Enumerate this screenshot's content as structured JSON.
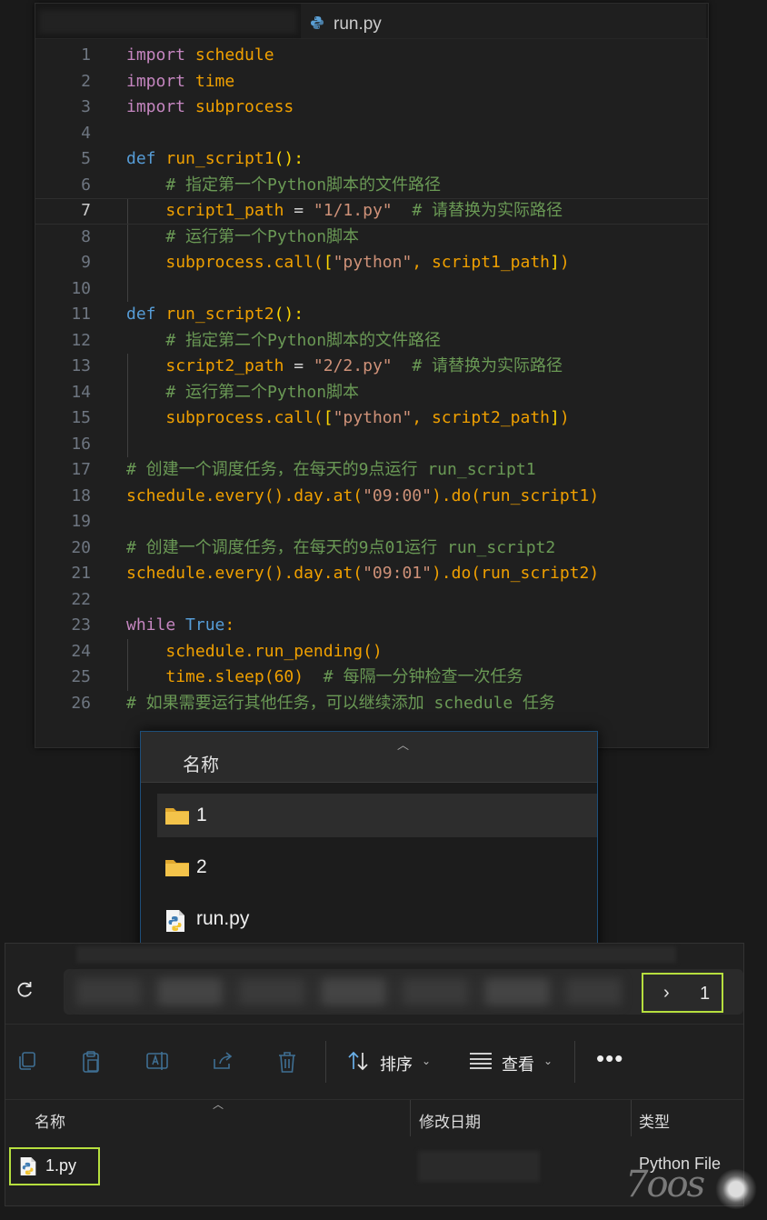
{
  "editor": {
    "tab_label": "run.py",
    "current_line": 7,
    "lines": [
      {
        "n": "1",
        "parts": [
          [
            "kw",
            "import"
          ],
          [
            "pl",
            " "
          ],
          [
            "or",
            "schedule"
          ]
        ]
      },
      {
        "n": "2",
        "parts": [
          [
            "kw",
            "import"
          ],
          [
            "pl",
            " "
          ],
          [
            "or",
            "time"
          ]
        ]
      },
      {
        "n": "3",
        "parts": [
          [
            "kw",
            "import"
          ],
          [
            "pl",
            " "
          ],
          [
            "or",
            "subprocess"
          ]
        ]
      },
      {
        "n": "4",
        "parts": []
      },
      {
        "n": "5",
        "parts": [
          [
            "def",
            "def"
          ],
          [
            "pl",
            " "
          ],
          [
            "or",
            "run_script1"
          ],
          [
            "br",
            "():"
          ]
        ]
      },
      {
        "n": "6",
        "parts": [
          [
            "pl",
            "    "
          ],
          [
            "cm",
            "# 指定第一个Python脚本的文件路径"
          ]
        ]
      },
      {
        "n": "7",
        "parts": [
          [
            "pl",
            "    "
          ],
          [
            "or",
            "script1_path"
          ],
          [
            "pl",
            " = "
          ],
          [
            "str",
            "\"1/1.py\""
          ],
          [
            "pl",
            "  "
          ],
          [
            "cm",
            "# 请替换为实际路径"
          ]
        ]
      },
      {
        "n": "8",
        "parts": [
          [
            "pl",
            "    "
          ],
          [
            "cm",
            "# 运行第一个Python脚本"
          ]
        ]
      },
      {
        "n": "9",
        "parts": [
          [
            "pl",
            "    "
          ],
          [
            "or",
            "subprocess.call("
          ],
          [
            "br",
            "["
          ],
          [
            "str",
            "\"python\""
          ],
          [
            "or",
            ", script1_path"
          ],
          [
            "br",
            "]"
          ],
          [
            "or",
            ")"
          ]
        ]
      },
      {
        "n": "10",
        "parts": []
      },
      {
        "n": "11",
        "parts": [
          [
            "def",
            "def"
          ],
          [
            "pl",
            " "
          ],
          [
            "or",
            "run_script2"
          ],
          [
            "br",
            "():"
          ]
        ]
      },
      {
        "n": "12",
        "parts": [
          [
            "pl",
            "    "
          ],
          [
            "cm",
            "# 指定第二个Python脚本的文件路径"
          ]
        ]
      },
      {
        "n": "13",
        "parts": [
          [
            "pl",
            "    "
          ],
          [
            "or",
            "script2_path"
          ],
          [
            "pl",
            " = "
          ],
          [
            "str",
            "\"2/2.py\""
          ],
          [
            "pl",
            "  "
          ],
          [
            "cm",
            "# 请替换为实际路径"
          ]
        ]
      },
      {
        "n": "14",
        "parts": [
          [
            "pl",
            "    "
          ],
          [
            "cm",
            "# 运行第二个Python脚本"
          ]
        ]
      },
      {
        "n": "15",
        "parts": [
          [
            "pl",
            "    "
          ],
          [
            "or",
            "subprocess.call("
          ],
          [
            "br",
            "["
          ],
          [
            "str",
            "\"python\""
          ],
          [
            "or",
            ", script2_path"
          ],
          [
            "br",
            "]"
          ],
          [
            "or",
            ")"
          ]
        ]
      },
      {
        "n": "16",
        "parts": []
      },
      {
        "n": "17",
        "parts": [
          [
            "cm",
            "# 创建一个调度任务，在每天的9点运行 run_script1"
          ]
        ]
      },
      {
        "n": "18",
        "parts": [
          [
            "or",
            "schedule.every().day.at("
          ],
          [
            "str",
            "\"09:00\""
          ],
          [
            "or",
            ").do(run_script1)"
          ]
        ]
      },
      {
        "n": "19",
        "parts": []
      },
      {
        "n": "20",
        "parts": [
          [
            "cm",
            "# 创建一个调度任务，在每天的9点01运行 run_script2"
          ]
        ]
      },
      {
        "n": "21",
        "parts": [
          [
            "or",
            "schedule.every().day.at("
          ],
          [
            "str",
            "\"09:01\""
          ],
          [
            "or",
            ").do(run_script2)"
          ]
        ]
      },
      {
        "n": "22",
        "parts": []
      },
      {
        "n": "23",
        "parts": [
          [
            "kw",
            "while"
          ],
          [
            "pl",
            " "
          ],
          [
            "def",
            "True"
          ],
          [
            "or",
            ":"
          ]
        ]
      },
      {
        "n": "24",
        "parts": [
          [
            "pl",
            "    "
          ],
          [
            "or",
            "schedule.run_pending()"
          ]
        ]
      },
      {
        "n": "25",
        "parts": [
          [
            "pl",
            "    "
          ],
          [
            "or",
            "time.sleep(60)"
          ],
          [
            "pl",
            "  "
          ],
          [
            "cm",
            "# 每隔一分钟检查一次任务"
          ]
        ]
      },
      {
        "n": "26",
        "parts": [
          [
            "cm",
            "# 如果需要运行其他任务，可以继续添加 schedule 任务"
          ]
        ]
      }
    ]
  },
  "popup": {
    "header": "名称",
    "items": [
      {
        "label": "1",
        "icon": "folder-icon",
        "selected": true
      },
      {
        "label": "2",
        "icon": "folder-icon",
        "selected": false
      },
      {
        "label": "run.py",
        "icon": "python-file-icon",
        "selected": false
      }
    ]
  },
  "explorer": {
    "breadcrumb": {
      "chevron": "›",
      "current": "1"
    },
    "toolbar": {
      "sort_label": "排序",
      "view_label": "查看",
      "more": "•••",
      "chevron": "⌄"
    },
    "columns": {
      "name": "名称",
      "modified": "修改日期",
      "type": "类型"
    },
    "file": {
      "name": "1.py",
      "type": "Python File"
    }
  },
  "watermark": "7oos",
  "colors": {
    "accent_highlight": "#b6df3e",
    "editor_bg": "#1f1f1f",
    "string": "#ce9178",
    "comment": "#6a9955",
    "keyword": "#c586c0",
    "def": "#569cd6",
    "identifier": "#f0a000",
    "folder": "#f3c34a"
  }
}
